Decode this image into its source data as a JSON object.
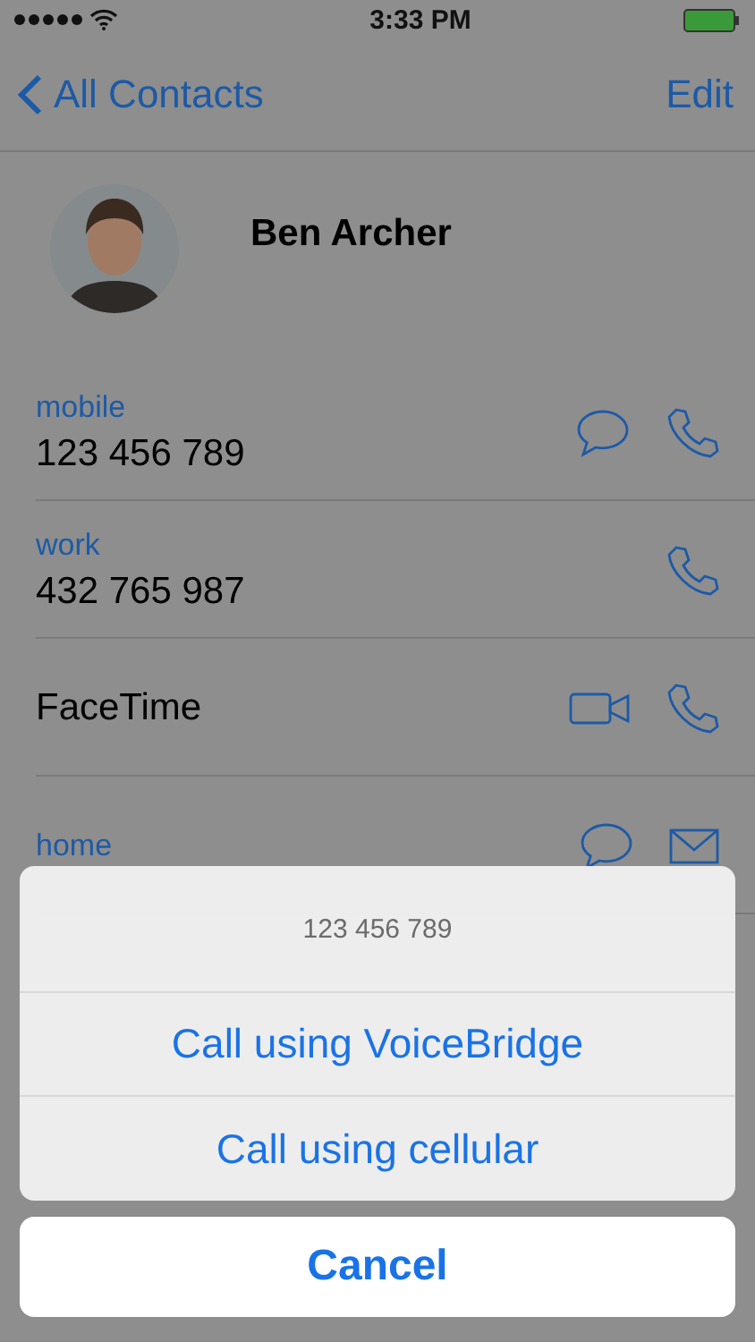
{
  "status_bar": {
    "time": "3:33 PM"
  },
  "nav": {
    "back": "All Contacts",
    "action": "Edit"
  },
  "contact": {
    "name": "Ben Archer"
  },
  "fields": [
    {
      "label": "mobile",
      "value": "123 456 789",
      "actions": [
        {
          "kind": "message"
        },
        {
          "kind": "call"
        }
      ]
    },
    {
      "label": "work",
      "value": "432 765 987",
      "actions": [
        {
          "kind": "call"
        }
      ]
    },
    {
      "value": "FaceTime",
      "actions": [
        {
          "kind": "video"
        },
        {
          "kind": "call"
        }
      ]
    },
    {
      "label": "home",
      "actions": [
        {
          "kind": "message"
        },
        {
          "kind": "mail"
        }
      ]
    }
  ],
  "action_sheet": {
    "title": "123 456 789",
    "options": [
      "Call using VoiceBridge",
      "Call using cellular"
    ],
    "cancel": "Cancel"
  }
}
